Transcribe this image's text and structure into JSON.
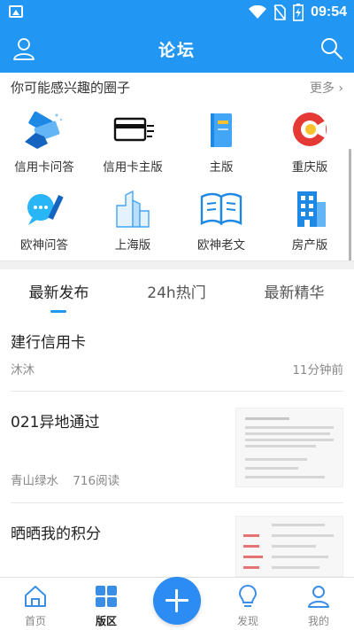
{
  "status_bar": {
    "time": "09:54",
    "icons": [
      "image-icon",
      "wifi-icon",
      "no-sim-icon",
      "battery-charging-icon"
    ]
  },
  "app_bar": {
    "title": "论坛",
    "left_icon": "user-icon",
    "right_icon": "search-icon"
  },
  "circles": {
    "title": "你可能感兴趣的圈子",
    "more_label": "更多",
    "items": [
      {
        "label": "信用卡问答",
        "icon": "credit-card-hand-icon"
      },
      {
        "label": "信用卡主版",
        "icon": "credit-card-icon"
      },
      {
        "label": "主版",
        "icon": "book-icon"
      },
      {
        "label": "重庆版",
        "icon": "chongqing-logo-icon"
      },
      {
        "label": "欧神问答",
        "icon": "chat-pen-icon"
      },
      {
        "label": "上海版",
        "icon": "skyscraper-icon"
      },
      {
        "label": "欧神老文",
        "icon": "open-book-icon"
      },
      {
        "label": "房产版",
        "icon": "building-icon"
      }
    ]
  },
  "tabs": [
    {
      "label": "最新发布",
      "active": true
    },
    {
      "label": "24h热门",
      "active": false
    },
    {
      "label": "最新精华",
      "active": false
    }
  ],
  "posts": [
    {
      "title": "建行信用卡",
      "author": "沐沐",
      "views": "",
      "time": "11分钟前",
      "has_thumb": false
    },
    {
      "title": "021异地通过",
      "author": "青山绿水",
      "views": "716阅读",
      "time": "",
      "has_thumb": true
    },
    {
      "title": "晒晒我的积分",
      "author": "",
      "views": "",
      "time": "",
      "has_thumb": true
    }
  ],
  "bottom_nav": [
    {
      "label": "首页",
      "icon": "home-icon",
      "active": false
    },
    {
      "label": "版区",
      "icon": "grid-icon",
      "active": true
    },
    {
      "label": "",
      "icon": "plus-icon",
      "active": false
    },
    {
      "label": "发现",
      "icon": "lightbulb-icon",
      "active": false
    },
    {
      "label": "我的",
      "icon": "profile-icon",
      "active": false
    }
  ],
  "colors": {
    "primary": "#2196f3",
    "fab": "#2c8cf4",
    "text": "#222222",
    "muted": "#888888"
  }
}
